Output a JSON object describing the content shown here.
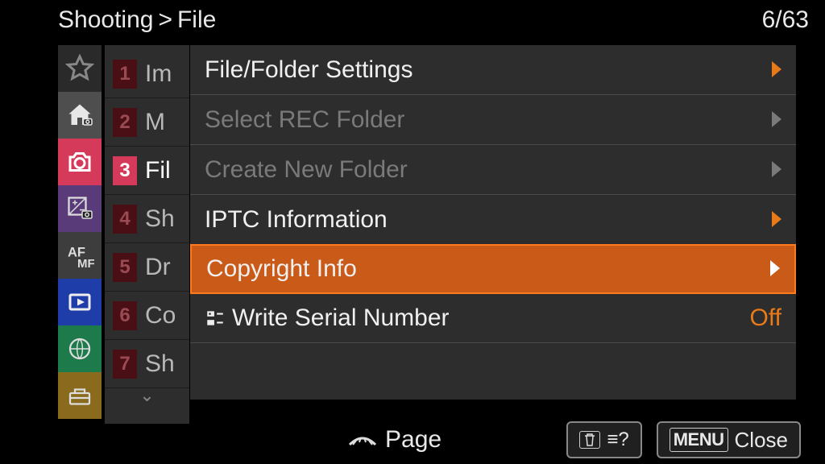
{
  "breadcrumb": {
    "root": "Shooting",
    "sep": ">",
    "leaf": "File"
  },
  "page": {
    "current": 6,
    "total": 63
  },
  "iconrail": [
    {
      "name": "star-icon"
    },
    {
      "name": "home-icon"
    },
    {
      "name": "camera-icon"
    },
    {
      "name": "exposure-icon"
    },
    {
      "name": "afmf-icon"
    },
    {
      "name": "play-icon"
    },
    {
      "name": "network-icon"
    },
    {
      "name": "toolbox-icon"
    }
  ],
  "sublist": [
    {
      "num": "1",
      "label": "Im"
    },
    {
      "num": "2",
      "label": "M"
    },
    {
      "num": "3",
      "label": "Fil",
      "active": true
    },
    {
      "num": "4",
      "label": "Sh"
    },
    {
      "num": "5",
      "label": "Dr"
    },
    {
      "num": "6",
      "label": "Co"
    },
    {
      "num": "7",
      "label": "Sh"
    }
  ],
  "rows": [
    {
      "label": "File/Folder Settings",
      "state": "enabled",
      "arrow": "orange"
    },
    {
      "label": "Select REC Folder",
      "state": "disabled",
      "arrow": "grey"
    },
    {
      "label": "Create New Folder",
      "state": "disabled",
      "arrow": "grey"
    },
    {
      "label": "IPTC Information",
      "state": "enabled",
      "arrow": "orange"
    },
    {
      "label": "Copyright Info",
      "state": "enabled",
      "selected": true,
      "arrow": "white"
    },
    {
      "label": "Write Serial Number",
      "state": "enabled",
      "value": "Off",
      "icon": "serial"
    }
  ],
  "bottom": {
    "page_label": "Page",
    "help_btn": "",
    "close_label": "Close",
    "menu_tag": "MENU"
  }
}
